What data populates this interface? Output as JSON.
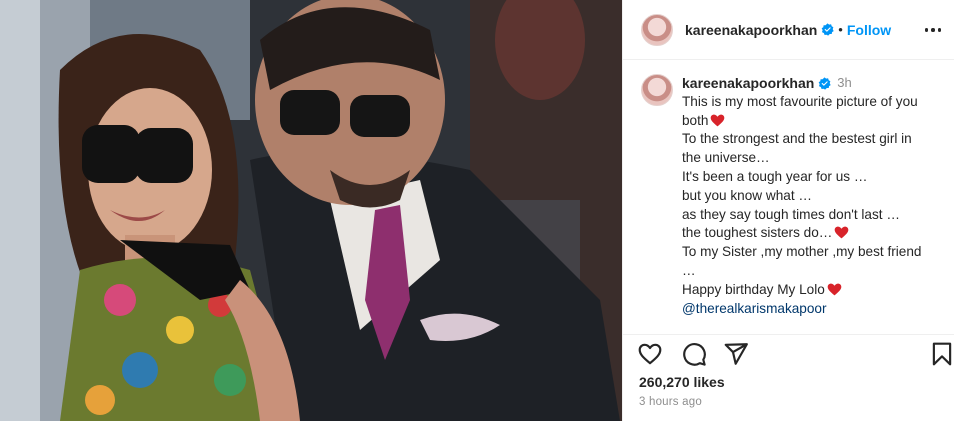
{
  "post": {
    "username": "kareenakapoorkhan",
    "follow_label": "Follow",
    "separator": "•",
    "caption_time": "3h",
    "caption_lines": [
      "This is my most favourite picture of you",
      "both",
      "To the strongest and the bestest girl in",
      "the universe…",
      "It's been a tough year for us …",
      "but you know what …",
      "as they say tough times don't last …",
      "the toughest sisters do…",
      "To my Sister ,my mother ,my best friend",
      "…",
      "Happy birthday My Lolo"
    ],
    "mention": "@therealkarismakapoor",
    "likes": "260,270 likes",
    "posted_ago": "3 hours ago"
  },
  "icons": {
    "verified": "verified-badge-icon",
    "more": "more-options-icon",
    "like": "heart-outline-icon",
    "comment": "comment-icon",
    "share": "paper-plane-icon",
    "save": "bookmark-icon",
    "emoji": "red-heart-emoji"
  },
  "colors": {
    "link_blue": "#0095f6",
    "verified_blue": "#0095f6",
    "mention_blue": "#00376b",
    "muted_gray": "#8e8e8e",
    "heart_red": "#d8232a"
  }
}
